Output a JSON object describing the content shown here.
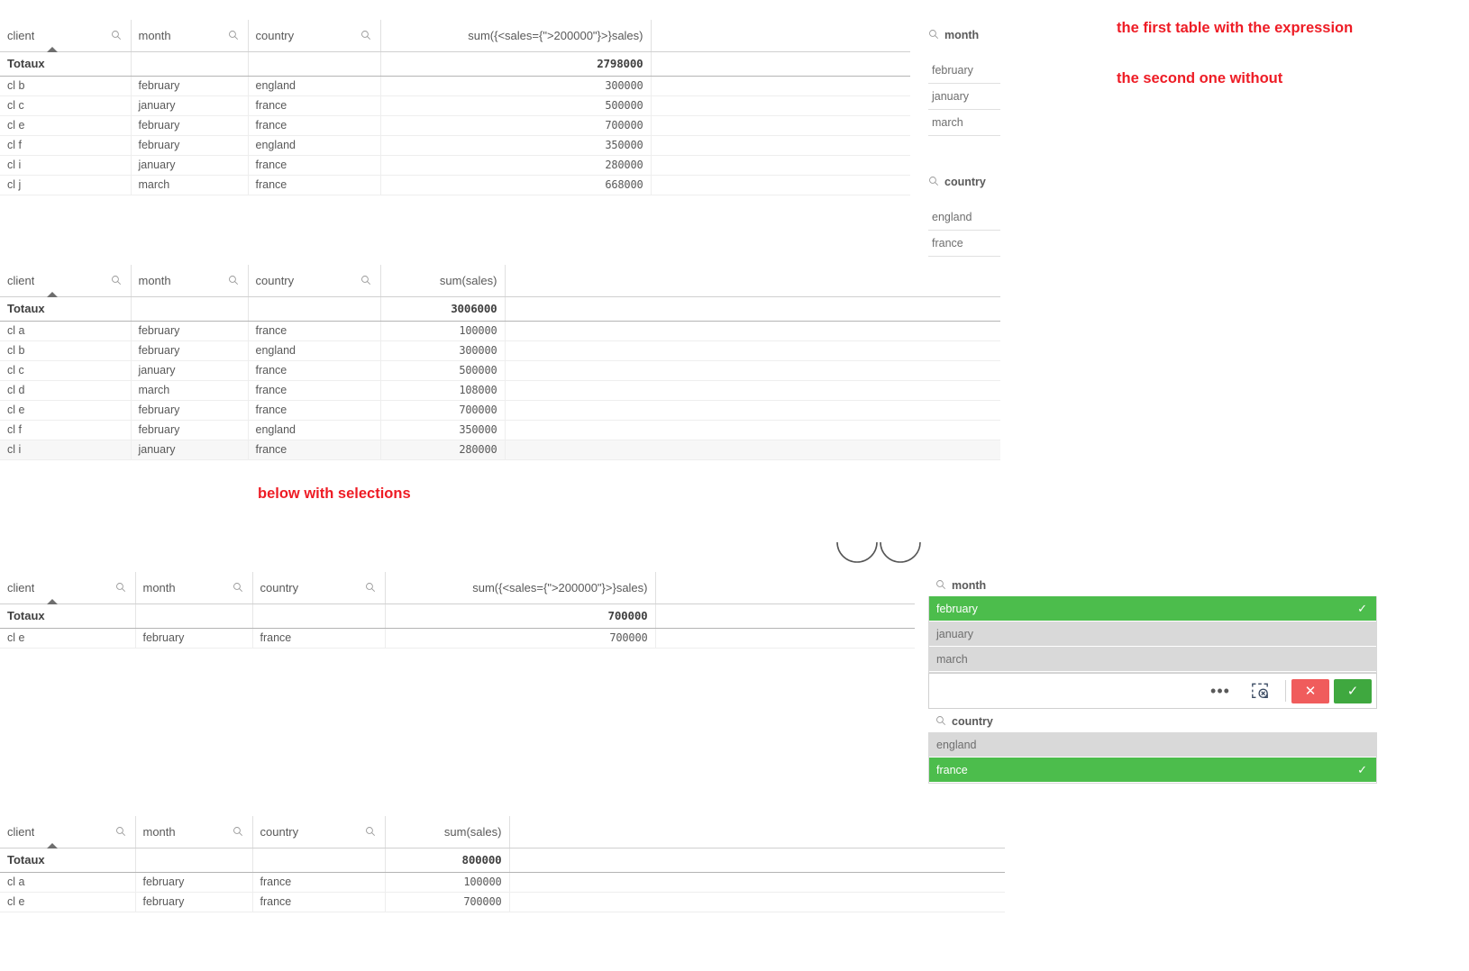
{
  "columns": {
    "client": "client",
    "month": "month",
    "country": "country"
  },
  "measures": {
    "set_expression": "sum({<sales={\">200000\"}>}sales)",
    "plain": "sum(sales)"
  },
  "total_label": "Totaux",
  "icons": {
    "search": "search-icon",
    "sort_ascending": "sort-ascending-caret",
    "more": "•••",
    "clear_selection": "clear-selection-icon",
    "cancel": "✕",
    "confirm": "✓"
  },
  "colors": {
    "selected_green": "#4cbd4c",
    "confirm_green": "#3fa83f",
    "cancel_red": "#f05c5c",
    "excluded_gray": "#d9d9d9",
    "annotation_red": "#ee1c25"
  },
  "table1": {
    "name": "table-with-set-expression-no-selection",
    "headers": [
      "client",
      "month",
      "country",
      "sum({<sales={\">200000\"}>}sales)"
    ],
    "total": {
      "label": "Totaux",
      "value": "2798000"
    },
    "rows": [
      {
        "client": "cl b",
        "month": "february",
        "country": "england",
        "value": "300000"
      },
      {
        "client": "cl c",
        "month": "january",
        "country": "france",
        "value": "500000"
      },
      {
        "client": "cl e",
        "month": "february",
        "country": "france",
        "value": "700000"
      },
      {
        "client": "cl f",
        "month": "february",
        "country": "england",
        "value": "350000"
      },
      {
        "client": "cl i",
        "month": "january",
        "country": "france",
        "value": "280000"
      },
      {
        "client": "cl j",
        "month": "march",
        "country": "france",
        "value": "668000"
      }
    ]
  },
  "table2": {
    "name": "table-plain-sum-no-selection",
    "headers": [
      "client",
      "month",
      "country",
      "sum(sales)"
    ],
    "total": {
      "label": "Totaux",
      "value": "3006000"
    },
    "rows": [
      {
        "client": "cl a",
        "month": "february",
        "country": "france",
        "value": "100000"
      },
      {
        "client": "cl b",
        "month": "february",
        "country": "england",
        "value": "300000"
      },
      {
        "client": "cl c",
        "month": "january",
        "country": "france",
        "value": "500000"
      },
      {
        "client": "cl d",
        "month": "march",
        "country": "france",
        "value": "108000"
      },
      {
        "client": "cl e",
        "month": "february",
        "country": "france",
        "value": "700000"
      },
      {
        "client": "cl f",
        "month": "february",
        "country": "england",
        "value": "350000"
      },
      {
        "client": "cl i",
        "month": "january",
        "country": "france",
        "value": "280000"
      }
    ]
  },
  "table3": {
    "name": "table-with-set-expression-with-selection",
    "headers": [
      "client",
      "month",
      "country",
      "sum({<sales={\">200000\"}>}sales)"
    ],
    "total": {
      "label": "Totaux",
      "value": "700000"
    },
    "rows": [
      {
        "client": "cl e",
        "month": "february",
        "country": "france",
        "value": "700000"
      }
    ]
  },
  "table4": {
    "name": "table-plain-sum-with-selection",
    "headers": [
      "client",
      "month",
      "country",
      "sum(sales)"
    ],
    "total": {
      "label": "Totaux",
      "value": "800000"
    },
    "rows": [
      {
        "client": "cl a",
        "month": "february",
        "country": "france",
        "value": "100000"
      },
      {
        "client": "cl e",
        "month": "february",
        "country": "france",
        "value": "700000"
      }
    ]
  },
  "filter_month": {
    "title": "month",
    "items": [
      "february",
      "january",
      "march"
    ]
  },
  "filter_country": {
    "title": "country",
    "items": [
      "england",
      "france"
    ]
  },
  "selection_month": {
    "title": "month",
    "items": [
      {
        "label": "february",
        "state": "selected"
      },
      {
        "label": "january",
        "state": "excluded"
      },
      {
        "label": "march",
        "state": "excluded"
      }
    ]
  },
  "selection_country": {
    "title": "country",
    "items": [
      {
        "label": "england",
        "state": "excluded"
      },
      {
        "label": "france",
        "state": "selected"
      }
    ]
  },
  "annotations": {
    "first": "the first table with the expression",
    "second": "the second one without",
    "third": "below with selections"
  }
}
